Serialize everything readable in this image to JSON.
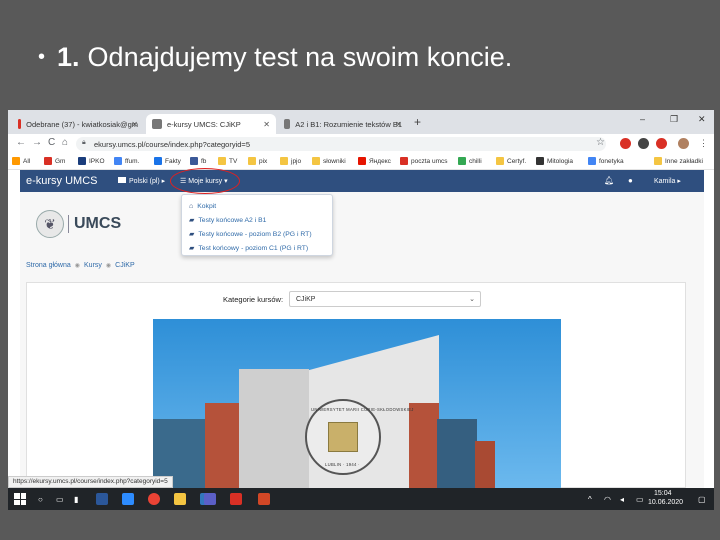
{
  "slide": {
    "bullet": "•",
    "number": "1.",
    "text": "Odnajdujemy test na swoim koncie."
  },
  "browser": {
    "tabs": [
      {
        "label": "Odebrane (37) - kwiatkosiak@gm",
        "icon": "gmail-icon",
        "icon_color": "#d93025"
      },
      {
        "label": "e-kursy UMCS: CJiKP",
        "icon": "moodle-icon",
        "icon_color": "#555555"
      },
      {
        "label": "A2 i B1: Rozumienie tekstów B1",
        "icon": "moodle-icon",
        "icon_color": "#555555"
      }
    ],
    "new_tab": "+",
    "window_controls": {
      "minimize": "–",
      "maximize": "❐",
      "close": "✕"
    },
    "nav": {
      "back": "←",
      "forward": "→",
      "reload": "C",
      "home": "⌂"
    },
    "url": "ekursy.umcs.pl/course/index.php?categoryid=5",
    "star": "☆",
    "bookmarks": [
      {
        "label": "All",
        "color": "#ff9900"
      },
      {
        "label": "Gm",
        "color": "#d93025"
      },
      {
        "label": "IPKO",
        "color": "#1a3d7c"
      },
      {
        "label": "ffum.",
        "color": "#4285f4"
      },
      {
        "label": "Fakty",
        "color": "#1a73e8"
      },
      {
        "label": "fb",
        "color": "#3b5998"
      },
      {
        "label": "TV",
        "color": "#f4c542"
      },
      {
        "label": "pix",
        "color": "#f4c542"
      },
      {
        "label": "jpjo",
        "color": "#f4c542"
      },
      {
        "label": "słowniki",
        "color": "#f4c542"
      },
      {
        "label": "Яндекс",
        "color": "#e61400"
      },
      {
        "label": "poczta umcs",
        "color": "#d93025"
      },
      {
        "label": "chilli",
        "color": "#34a853"
      },
      {
        "label": "Certyf.",
        "color": "#f4c542"
      },
      {
        "label": "Mitologia",
        "color": "#333333"
      },
      {
        "label": "fonetyka",
        "color": "#4285f4"
      },
      {
        "label": "Inne zakładki",
        "color": "#f4c542"
      }
    ]
  },
  "site": {
    "brand": "e-kursy UMCS",
    "language": "Polski (pl) ▸",
    "my_courses": "Moje kursy ▾",
    "user": "Kamila ▸",
    "logo_text": "UMCS",
    "dropdown": [
      {
        "label": "Kokpit",
        "icon": "home-icon"
      },
      {
        "label": "Testy końcowe A2 i B1",
        "icon": "graduation-cap-icon"
      },
      {
        "label": "Testy końcowe - poziom B2 (PG i RT)",
        "icon": "graduation-cap-icon"
      },
      {
        "label": "Test końcowy - poziom C1 (PG i RT)",
        "icon": "graduation-cap-icon"
      }
    ],
    "breadcrumb": [
      "Strona główna",
      "Kursy",
      "CJiKP"
    ],
    "category_label": "Kategorie kursów:",
    "category_value": "CJiKP",
    "seal_text_left": "UNIWERSYTET MARII CURIE-SKŁODOWSKIEJ",
    "seal_text_bottom": "LUBLIN · 1944 ·",
    "status_url": "https://ekursy.umcs.pl/course/index.php?categoryid=5"
  },
  "taskbar": {
    "time": "15:04",
    "date": "10.06.2020",
    "apps": [
      {
        "name": "word-icon",
        "color": "#2b579a"
      },
      {
        "name": "zoom-icon",
        "color": "#2d8cff"
      },
      {
        "name": "chrome-icon",
        "color": "#ea4335"
      },
      {
        "name": "folder-icon",
        "color": "#f4c542"
      },
      {
        "name": "edge-icon",
        "color": "#3277bc"
      },
      {
        "name": "teams-icon",
        "color": "#5b5fc7"
      },
      {
        "name": "acrobat-icon",
        "color": "#d93025"
      },
      {
        "name": "powerpoint-icon",
        "color": "#d24726"
      }
    ]
  }
}
